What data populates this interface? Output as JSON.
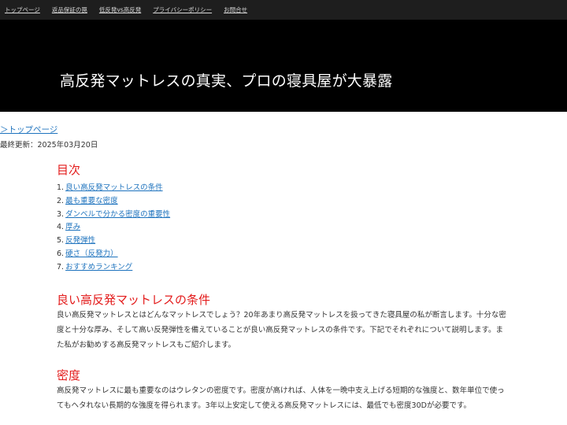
{
  "topnav": {
    "items": [
      "トップページ",
      "返品保証の罠",
      "低反発vs高反発",
      "プライバシーポリシー",
      "お問合せ"
    ]
  },
  "hero": {
    "title": "高反発マットレスの真実、プロの寝具屋が大暴露"
  },
  "breadcrumb": "＞トップページ",
  "updated": "最終更新：2025年03月20日",
  "toc": {
    "title": "目次",
    "items": [
      {
        "num": "1.",
        "label": "良い高反発マットレスの条件"
      },
      {
        "num": "2.",
        "label": "最も重要な密度"
      },
      {
        "num": "3.",
        "label": "ダンベルで分かる密度の重要性"
      },
      {
        "num": "4.",
        "label": "厚み"
      },
      {
        "num": "5.",
        "label": "反発弾性"
      },
      {
        "num": "6.",
        "label": "硬さ（反発力）"
      },
      {
        "num": "7.",
        "label": "おすすめランキング"
      }
    ]
  },
  "sections": [
    {
      "title": "良い高反発マットレスの条件",
      "body": "良い高反発マットレスとはどんなマットレスでしょう？20年あまり高反発マットレスを扱ってきた寝具屋の私が断言します。十分な密度と十分な厚み、そして高い反発弾性を備えていることが良い高反発マットレスの条件です。下記でそれぞれについて説明します。また私がお勧めする高反発マットレスもご紹介します。"
    },
    {
      "title": "密度",
      "body": "高反発マットレスに最も重要なのはウレタンの密度です。密度が高ければ、人体を一晩中支え上げる短期的な強度と、数年単位で使ってもヘタれない長期的な強度を得られます。3年以上安定して使える高反発マットレスには、最低でも密度30Dが必要です。"
    }
  ]
}
